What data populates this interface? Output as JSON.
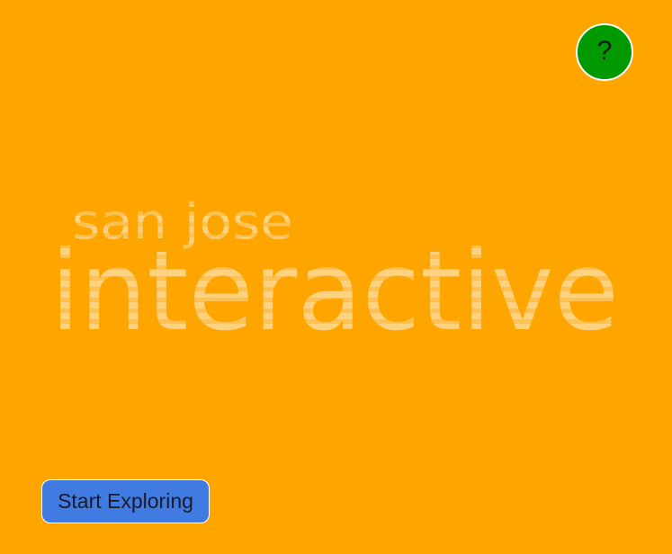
{
  "app": {
    "background_color": "#ffa500"
  },
  "help_button": {
    "label": "?",
    "color": "#009900",
    "icon": "question-icon"
  },
  "logo": {
    "line1": "san jose",
    "line2": "interactive",
    "color": "#ffffff"
  },
  "start_button": {
    "label": "Start Exploring",
    "color": "#3f7be0"
  }
}
